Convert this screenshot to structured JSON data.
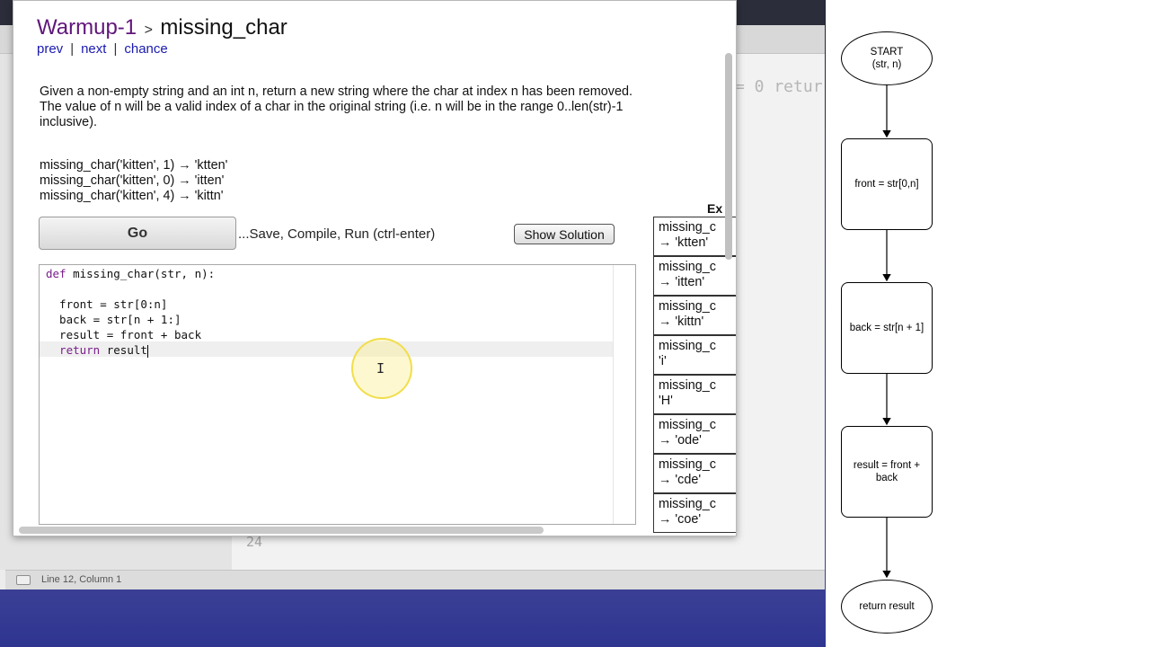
{
  "background_editor": {
    "code_fragment": "= 0 retur",
    "line_number": "24",
    "status_text": "Line 12, Column 1"
  },
  "codingbat": {
    "breadcrumb": {
      "section": "Warmup-1",
      "separator": ">",
      "problem": "missing_char"
    },
    "nav": {
      "prev": "prev",
      "next": "next",
      "chance": "chance",
      "divider": "|"
    },
    "description": "Given a non-empty string and an int n, return a new string where the char at index n has been removed. The value of n will be a valid index of a char in the original string (i.e. n will be in the range 0..len(str)-1 inclusive).",
    "examples": [
      "missing_char('kitten', 1) → 'ktten'",
      "missing_char('kitten', 0) → 'itten'",
      "missing_char('kitten', 4) → 'kittn'"
    ],
    "go_label": "Go",
    "go_hint": "...Save, Compile, Run (ctrl-enter)",
    "solution_label": "Show Solution",
    "code": {
      "line1_kw": "def",
      "line1_rest": " missing_char(str, n):",
      "line2": "",
      "line3": "  front = str[0:n]",
      "line4": "  back = str[n + 1:]",
      "line5": "  result = front + back",
      "line6_kw": "  return",
      "line6_rest": " result"
    },
    "expected_header": "Ex",
    "expected_cells": [
      {
        "l1": "missing_c",
        "l2": "→ 'ktten'"
      },
      {
        "l1": "missing_c",
        "l2": "→ 'itten'"
      },
      {
        "l1": "missing_c",
        "l2": "→ 'kittn'"
      },
      {
        "l1": "missing_c",
        "l2": "'i'"
      },
      {
        "l1": "missing_c",
        "l2": "'H'"
      },
      {
        "l1": "missing_c",
        "l2": "→ 'ode'"
      },
      {
        "l1": "missing_c",
        "l2": "→ 'cde'"
      },
      {
        "l1": "missing_c",
        "l2": "→ 'coe'"
      }
    ]
  },
  "flowchart": {
    "start_l1": "START",
    "start_l2": "(str, n)",
    "step1": "front = str[0,n]",
    "step2": "back = str[n + 1]",
    "step3": "result = front + back",
    "end": "return result"
  }
}
